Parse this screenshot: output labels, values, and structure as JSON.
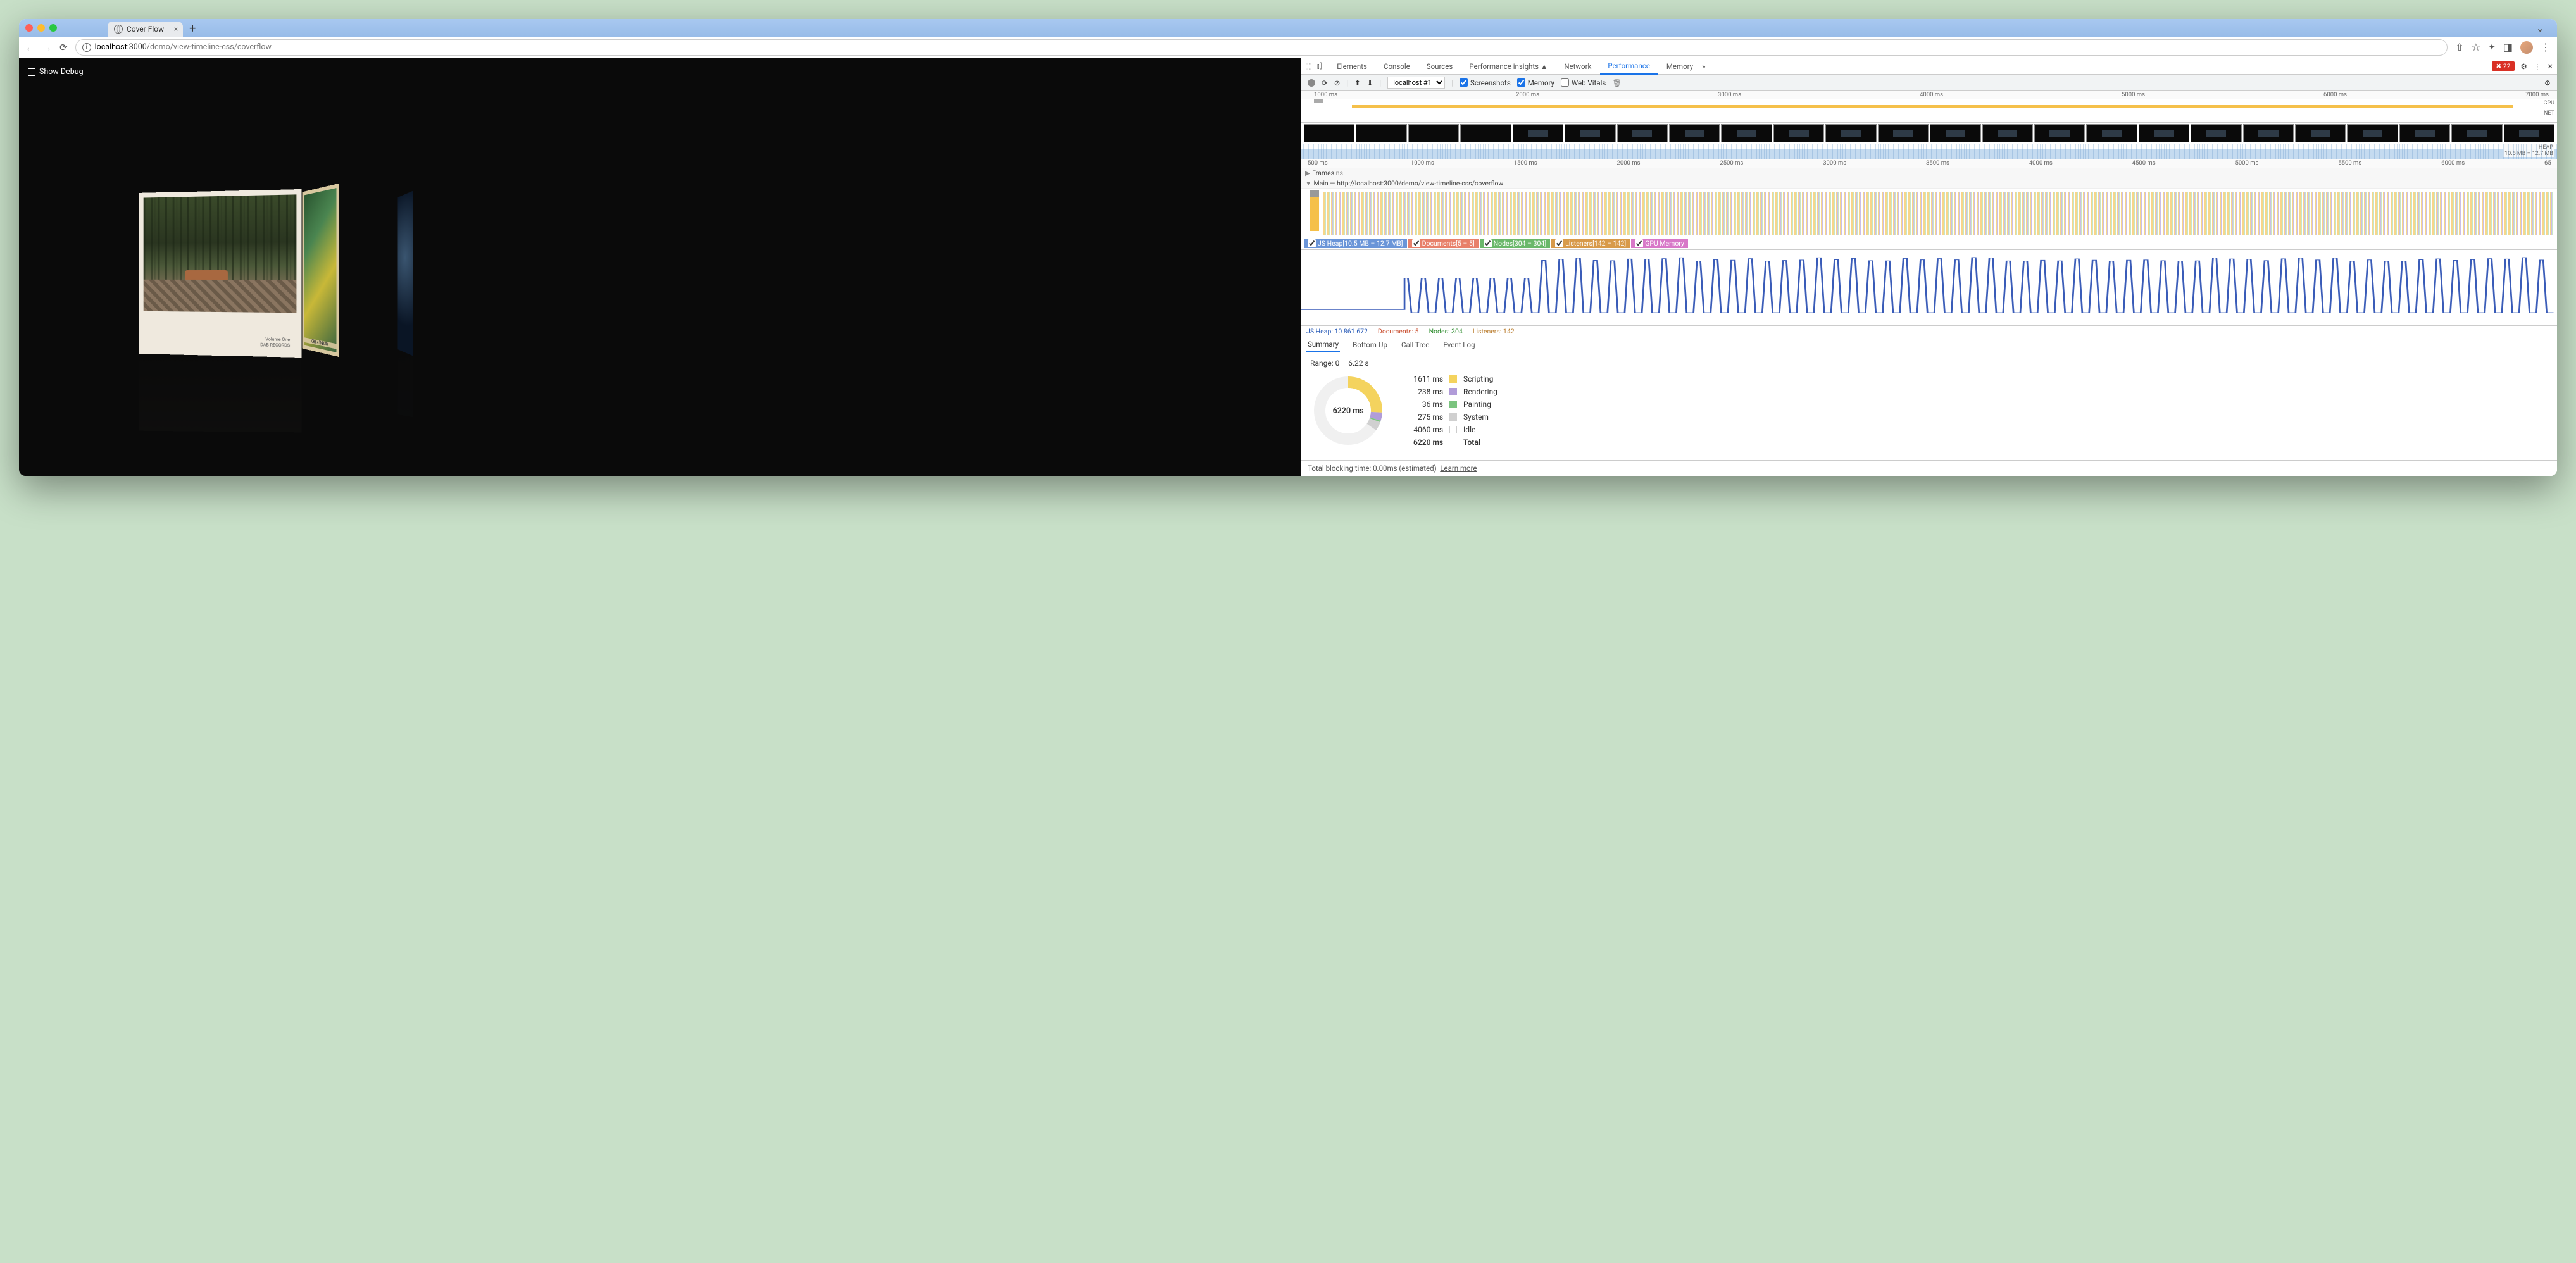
{
  "tab": {
    "title": "Cover Flow"
  },
  "address": {
    "host": "localhost",
    "port": ":3000",
    "path": "/demo/view-timeline-css/coverflow"
  },
  "page": {
    "debug_label": "Show Debug",
    "album1": {
      "line1": "Volume One",
      "line2": "DAB RECORDS"
    },
    "album2_side": "OR & 4 THEORY"
  },
  "devtools": {
    "tabs": [
      "Elements",
      "Console",
      "Sources",
      "Performance insights ▲",
      "Network",
      "Performance",
      "Memory"
    ],
    "active_tab": 5,
    "error_count": "22",
    "toolbar": {
      "dropdown": "localhost #1",
      "screenshots": "Screenshots",
      "memory": "Memory",
      "webvitals": "Web Vitals"
    },
    "ruler1": [
      "1000 ms",
      "2000 ms",
      "3000 ms",
      "4000 ms",
      "5000 ms",
      "6000 ms",
      "7000 ms"
    ],
    "ov_labels": {
      "cpu": "CPU",
      "net": "NET",
      "heap": "HEAP",
      "heap_range": "10.5 MB – 12.7 MB"
    },
    "ruler2": [
      "500 ms",
      "1000 ms",
      "1500 ms",
      "2000 ms",
      "2500 ms",
      "3000 ms",
      "3500 ms",
      "4000 ms",
      "4500 ms",
      "5000 ms",
      "5500 ms",
      "6000 ms",
      "65"
    ],
    "tracks": {
      "frames": "Frames",
      "frames_unit": "ns",
      "main": "Main — http://localhost:3000/demo/view-timeline-css/coverflow"
    },
    "mem_chips": {
      "heap": "JS Heap[10.5 MB – 12.7 MB]",
      "docs": "Documents[5 – 5]",
      "nodes": "Nodes[304 – 304]",
      "listeners": "Listeners[142 – 142]",
      "gpu": "GPU Memory"
    },
    "mem_stats": {
      "heap": "JS Heap: 10 861 672",
      "docs": "Documents: 5",
      "nodes": "Nodes: 304",
      "listeners": "Listeners: 142"
    },
    "summary_tabs": [
      "Summary",
      "Bottom-Up",
      "Call Tree",
      "Event Log"
    ],
    "range": "Range: 0 – 6.22 s",
    "donut_center": "6220 ms",
    "legend": [
      {
        "ms": "1611 ms",
        "label": "Scripting",
        "cls": "sc"
      },
      {
        "ms": "238 ms",
        "label": "Rendering",
        "cls": "re"
      },
      {
        "ms": "36 ms",
        "label": "Painting",
        "cls": "pa"
      },
      {
        "ms": "275 ms",
        "label": "System",
        "cls": "sy"
      },
      {
        "ms": "4060 ms",
        "label": "Idle",
        "cls": "id"
      },
      {
        "ms": "6220 ms",
        "label": "Total",
        "cls": ""
      }
    ],
    "footer": {
      "text": "Total blocking time: 0.00ms (estimated)",
      "link": "Learn more"
    }
  },
  "chart_data": {
    "type": "pie",
    "title": "6220 ms",
    "series": [
      {
        "name": "Scripting",
        "value": 1611,
        "unit": "ms"
      },
      {
        "name": "Rendering",
        "value": 238,
        "unit": "ms"
      },
      {
        "name": "Painting",
        "value": 36,
        "unit": "ms"
      },
      {
        "name": "System",
        "value": 275,
        "unit": "ms"
      },
      {
        "name": "Idle",
        "value": 4060,
        "unit": "ms"
      }
    ],
    "total": 6220
  }
}
